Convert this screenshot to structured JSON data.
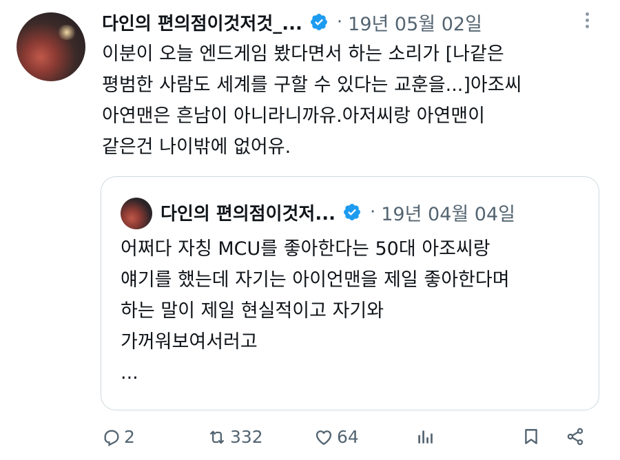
{
  "tweet": {
    "author_name": "다인의 편의점이것저것_...",
    "date": "19년 05월 02일",
    "separator": "·",
    "lines": [
      "이분이 오늘 엔드게임 봤다면서 하는 소리가 [나같은",
      "평범한 사람도 세계를 구할 수 있다는 교훈을...]아조씨",
      "아연맨은 흔남이 아니라니까유.아저씨랑 아연맨이",
      "같은건 나이밖에 없어유."
    ]
  },
  "quote": {
    "author_name": "다인의 편의점이것저...",
    "date": "19년 04월 04일",
    "separator": "·",
    "lines": [
      "어쩌다 자칭 MCU를 좋아한다는 50대 아조씨랑",
      "얘기를 했는데 자기는 아이언맨을 제일 좋아한다며",
      "하는 말이 제일 현실적이고 자기와",
      "가꺼워보여서러고",
      "..."
    ]
  },
  "actions": {
    "reply_count": "2",
    "retweet_count": "332",
    "like_count": "64"
  },
  "icons": {
    "verified": "verified-badge-icon",
    "more": "more-icon",
    "reply": "reply-icon",
    "retweet": "retweet-icon",
    "like": "heart-icon",
    "views": "analytics-icon",
    "bookmark": "bookmark-icon",
    "share": "share-icon"
  },
  "colors": {
    "accent": "#1d9bf0",
    "secondary_text": "#536471",
    "border": "#cfd9de"
  }
}
